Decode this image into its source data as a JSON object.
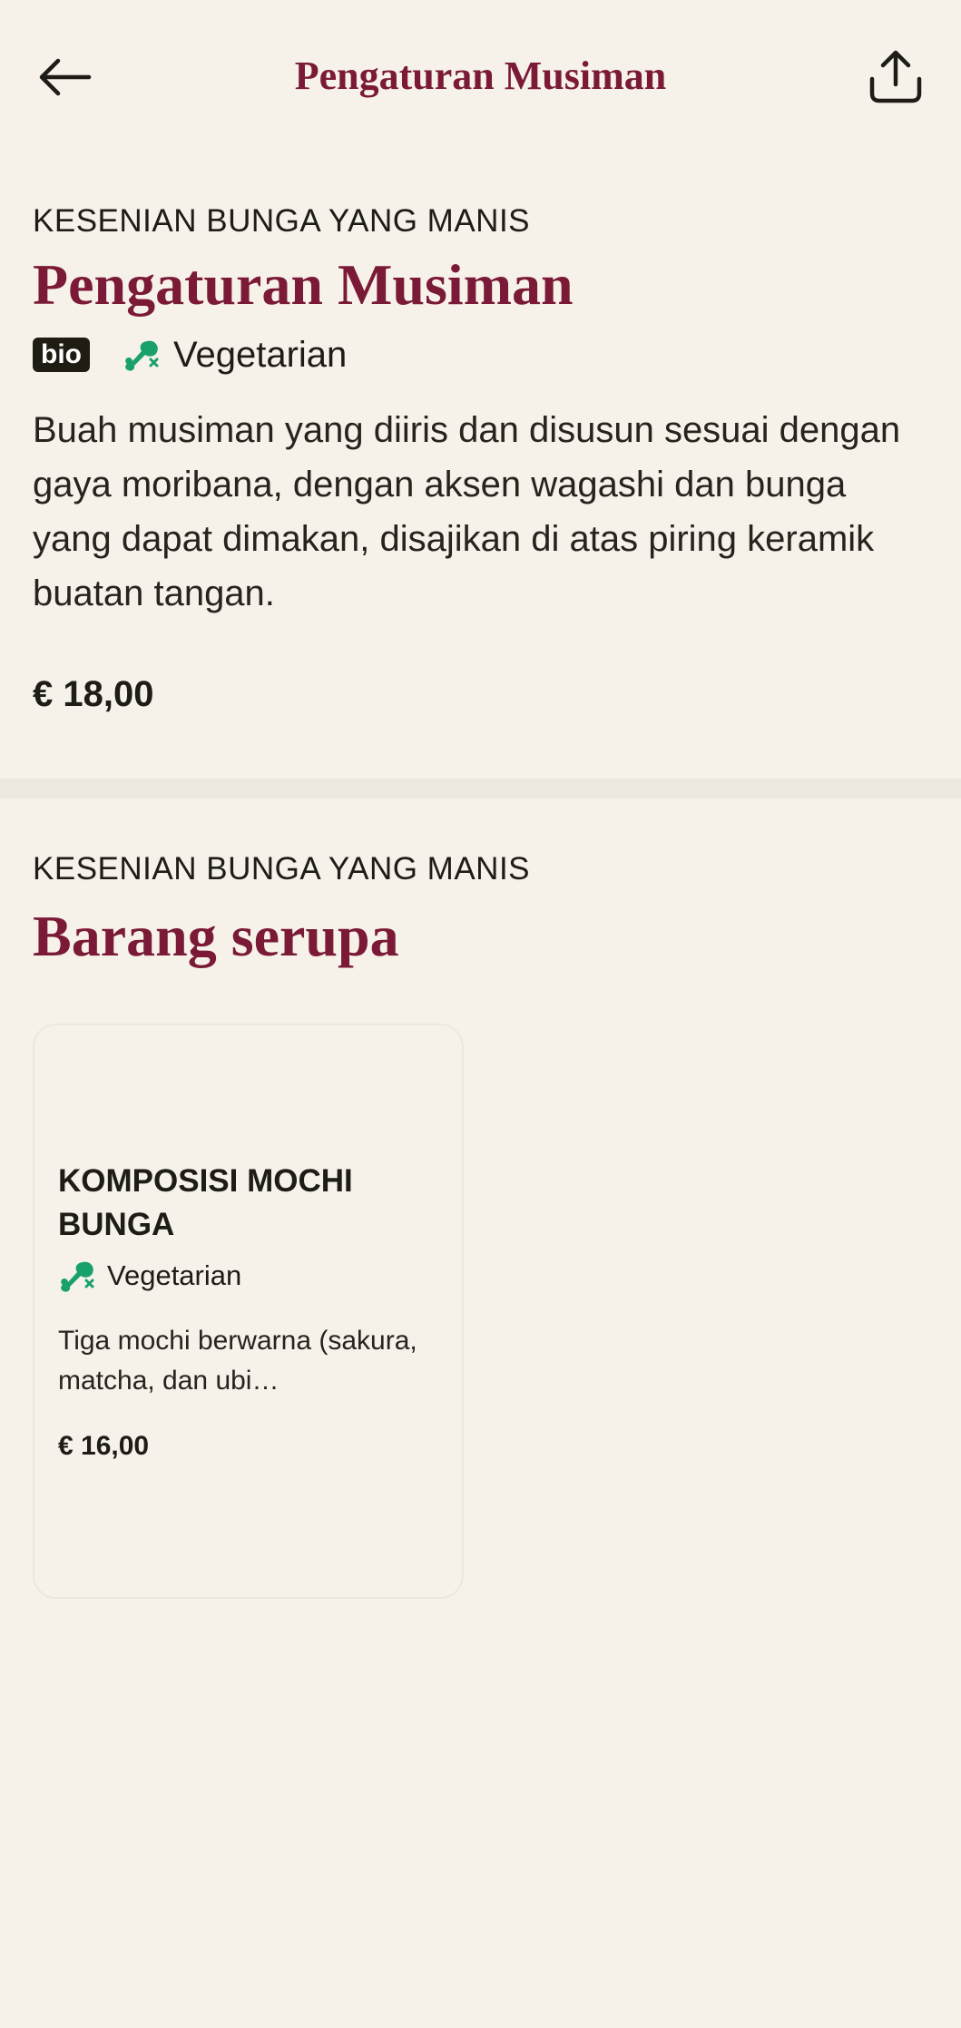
{
  "header": {
    "title": "Pengaturan Musiman",
    "back_icon": "arrow-left-icon",
    "share_icon": "share-icon"
  },
  "product": {
    "category": "KESENIAN BUNGA YANG MANIS",
    "title": "Pengaturan Musiman",
    "badge": "bio",
    "diet_icon": "leaf-drumstick-icon",
    "diet_label": "Vegetarian",
    "description": "Buah musiman yang diiris dan disusun sesuai dengan gaya moribana, dengan aksen wagashi dan bunga yang dapat dimakan, disajikan di atas piring keramik buatan tangan.",
    "price": "€ 18,00"
  },
  "similar": {
    "category": "KESENIAN BUNGA YANG MANIS",
    "title": "Barang serupa",
    "items": [
      {
        "title": "KOMPOSISI MOCHI BUNGA",
        "diet_label": "Vegetarian",
        "description": "Tiga mochi berwarna (sakura, matcha, dan ubi…",
        "price": "€ 16,00"
      }
    ]
  },
  "colors": {
    "background": "#f6f2ea",
    "accent": "#7b1a36",
    "veg_green": "#1aa06b",
    "badge_bg": "#1f1d13"
  }
}
